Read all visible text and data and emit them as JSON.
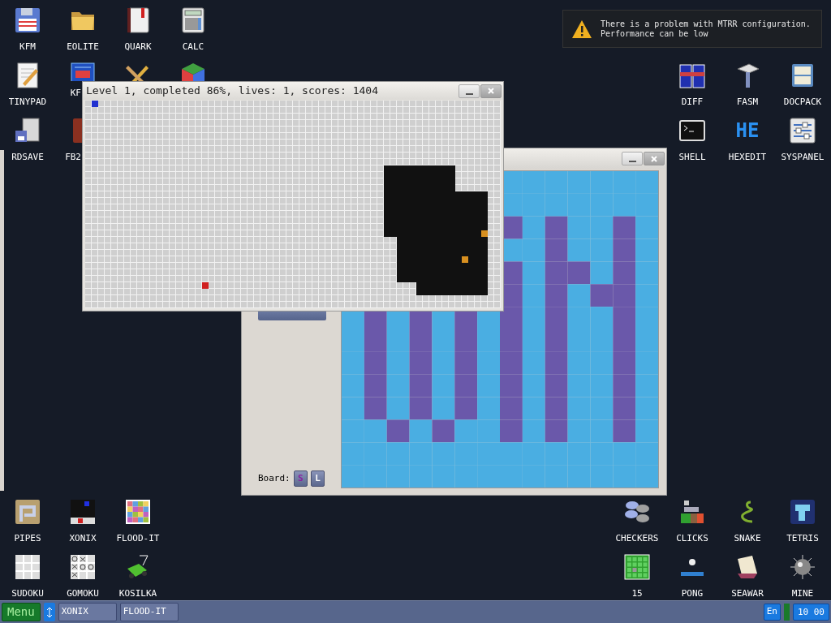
{
  "desktop": {
    "icon_groups": [
      {
        "icons": [
          {
            "label": "KFM",
            "kind": "floppy"
          },
          {
            "label": "EOLITE",
            "kind": "folder"
          },
          {
            "label": "QUARK",
            "kind": "notebook"
          },
          {
            "label": "CALC",
            "kind": "calculator"
          },
          {
            "label": "TINYPAD",
            "kind": "notepad"
          },
          {
            "label": "KF",
            "kind": "blueprint"
          },
          {
            "kind": "pencil"
          },
          {
            "kind": "cube"
          },
          {
            "label": "RDSAVE",
            "kind": "server"
          },
          {
            "label": "FB2",
            "kind": "redbook"
          }
        ]
      },
      {
        "icons": [
          {
            "label": "DIFF",
            "kind": "spreadsheet"
          },
          {
            "label": "FASM",
            "kind": "hammer"
          },
          {
            "label": "DOCPACK",
            "kind": "cabinet"
          },
          {
            "label": "SHELL",
            "kind": "terminal"
          },
          {
            "label": "HEXEDIT",
            "kind": "logo",
            "logo_text": "HE"
          },
          {
            "label": "SYSPANEL",
            "kind": "sliders"
          }
        ]
      },
      {
        "icons": [
          {
            "label": "PIPES",
            "kind": "pipes"
          },
          {
            "label": "XONIX",
            "kind": "xonix"
          },
          {
            "label": "FLOOD-IT",
            "kind": "mosaic"
          },
          {
            "label": "SUDOKU",
            "kind": "sudoku"
          },
          {
            "label": "GOMOKU",
            "kind": "gomoku"
          },
          {
            "label": "KOSILKA",
            "kind": "mower"
          }
        ]
      },
      {
        "icons": [
          {
            "label": "CHECKERS",
            "kind": "checkers"
          },
          {
            "label": "CLICKS",
            "kind": "blocks"
          },
          {
            "label": "SNAKE",
            "kind": "snake"
          },
          {
            "label": "TETRIS",
            "kind": "tetris"
          },
          {
            "label": "15",
            "kind": "fifteen"
          },
          {
            "label": "PONG",
            "kind": "pong"
          },
          {
            "label": "SEAWAR",
            "kind": "ship"
          },
          {
            "label": "MINE",
            "kind": "mine"
          }
        ]
      }
    ]
  },
  "notification": {
    "lines": [
      "There is a problem with MTRR configuration.",
      "Performance can be low"
    ]
  },
  "flood_window": {
    "board_label": "Board:",
    "board_sizes": [
      {
        "label": "S",
        "selected": true
      },
      {
        "label": "L",
        "selected": false
      }
    ]
  },
  "xonix_window": {
    "title": "Level 1, completed 86%, lives: 1, scores: 1404"
  },
  "taskbar": {
    "menu": "Menu",
    "tasks": [
      "XONIX",
      "FLOOD-IT"
    ],
    "language": "En",
    "clock": "10 00"
  }
}
